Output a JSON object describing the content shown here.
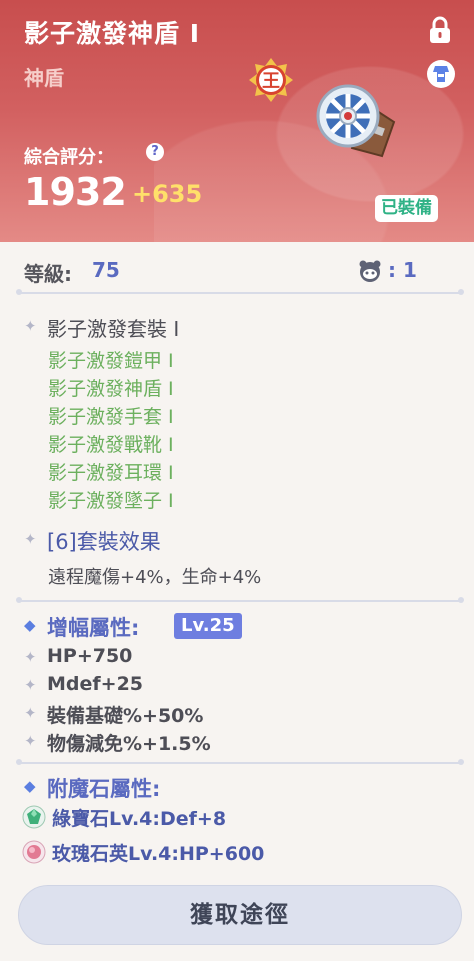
{
  "header": {
    "item_name": "影子激發神盾 I",
    "item_type": "神盾",
    "rank_glyph": "王",
    "score_label": "綜合評分：",
    "help_glyph": "?",
    "score_value": "1932",
    "score_bonus": "+635",
    "equipped_label": "已裝備",
    "icons": [
      "lock-icon",
      "slot-icon",
      "rank-badge-icon",
      "shield-icon"
    ]
  },
  "level": {
    "label": "等級:",
    "value": "75",
    "pet_value": ": 1"
  },
  "set": {
    "title": "影子激發套裝 I",
    "pieces": [
      "影子激發鎧甲 I",
      "影子激發神盾 I",
      "影子激發手套 I",
      "影子激發戰靴 I",
      "影子激發耳環 I",
      "影子激發墜子 I"
    ],
    "bonus_title": "[6]套裝效果",
    "bonus_desc": "遠程魔傷+4%，生命+4%"
  },
  "enhance": {
    "title": "增幅屬性:",
    "level_badge": "Lv.25",
    "stats": [
      "HP+750",
      "Mdef+25",
      "裝備基礎%+50%",
      "物傷減免%+1.5%"
    ]
  },
  "enchant": {
    "title": "附魔石屬性:",
    "gems": [
      {
        "text": "綠寶石Lv.4:Def+8",
        "icon": "emerald-icon",
        "color": "#3fb07a"
      },
      {
        "text": "玫瑰石英Lv.4:HP+600",
        "icon": "rose-quartz-icon",
        "color": "#e27a93"
      }
    ]
  },
  "acquire_button": "獲取途徑",
  "colors": {
    "header_red": "#c84e4e",
    "set_green": "#6cb05e",
    "accent_blue": "#5a6ac0",
    "equipped_green": "#2fb286",
    "bonus_yellow": "#ffe06a"
  }
}
